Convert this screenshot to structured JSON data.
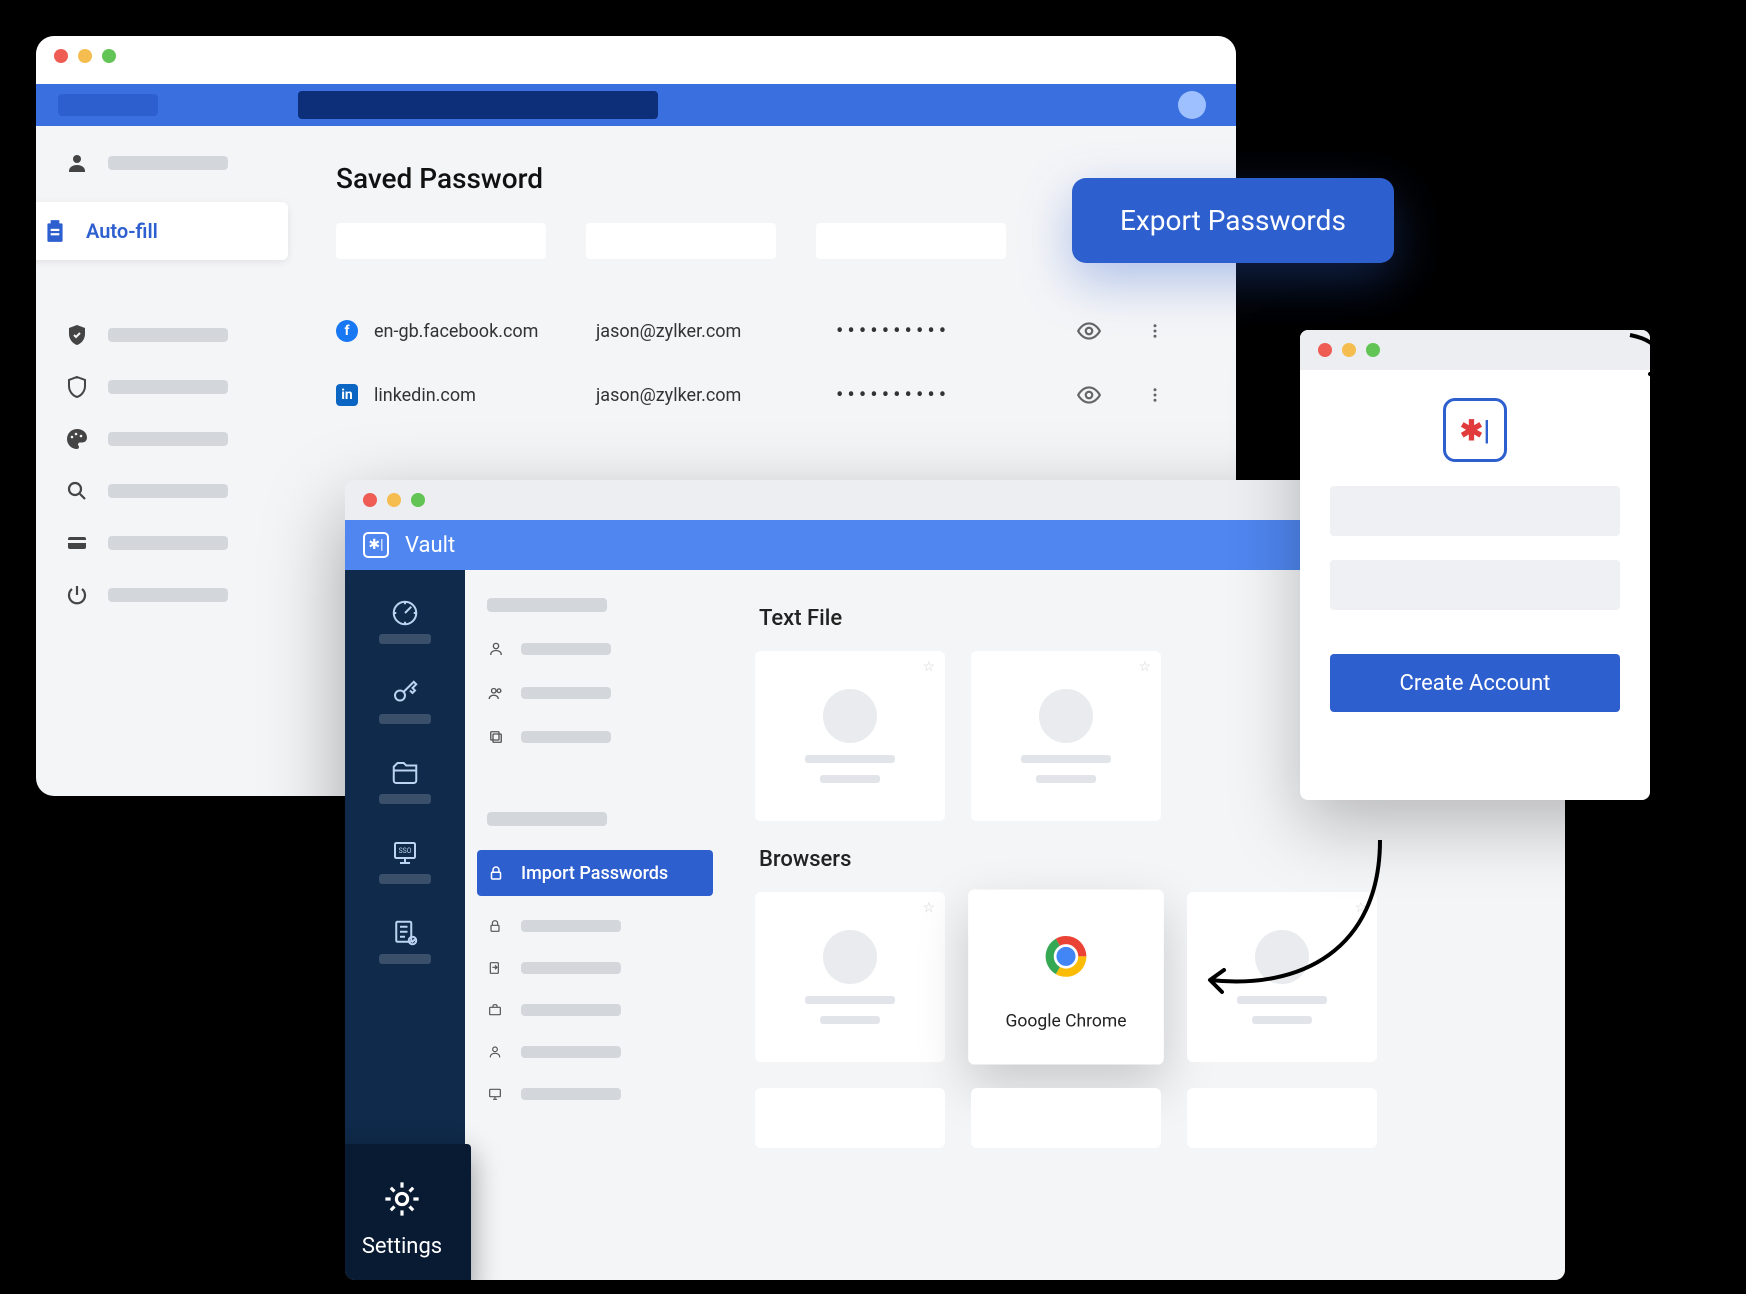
{
  "browser": {
    "title": "Saved Password",
    "sidebar": {
      "autofill_label": "Auto-fill"
    },
    "rows": [
      {
        "site": "en-gb.facebook.com",
        "user": "jason@zylker.com",
        "pwd": "••••••••••"
      },
      {
        "site": "linkedin.com",
        "user": "jason@zylker.com",
        "pwd": "••••••••••"
      }
    ]
  },
  "export_button": "Export Passwords",
  "vault": {
    "app_name": "Vault",
    "rail_settings": "Settings",
    "subnav_active": "Import Passwords",
    "section_textfile": "Text File",
    "section_browsers": "Browsers",
    "chrome_label": "Google Chrome"
  },
  "signup": {
    "create_label": "Create Account"
  }
}
